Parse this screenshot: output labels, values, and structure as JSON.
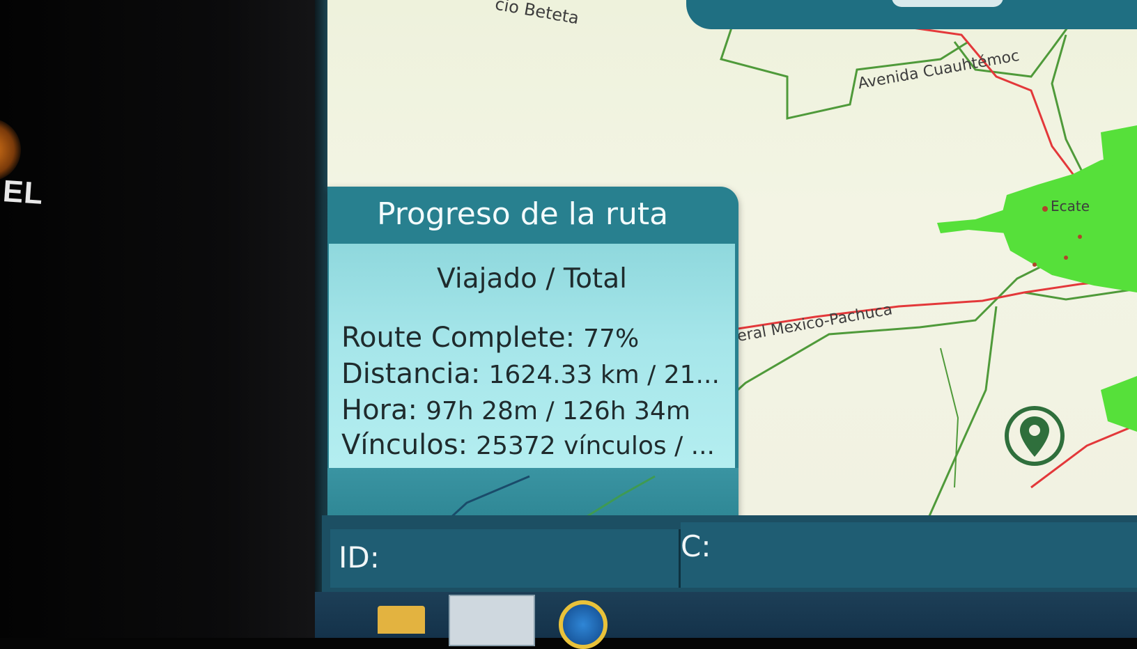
{
  "monitor_brand_text": "EL",
  "map": {
    "labels": {
      "top_left_street": "cio Beteta",
      "top_street": "Avenida Cuauhtémoc",
      "highway": "Federal Mexico-Pachuca",
      "town_right": "Ecate"
    }
  },
  "route_progress": {
    "title": "Progreso de la ruta",
    "subtitle": "Viajado / Total",
    "lines": [
      {
        "key": "Route Complete:",
        "value": "77%"
      },
      {
        "key": "Distancia:",
        "value": "1624.33 km / 21..."
      },
      {
        "key": "Hora:",
        "value": "97h 28m / 126h 34m"
      },
      {
        "key": "Vínculos:",
        "value": "25372 vínculos / ..."
      }
    ],
    "percent_complete": 77
  },
  "status_bar": {
    "id_label": "ID:",
    "c_label": "C:"
  },
  "icons": [
    "location-pin-icon",
    "folder-icon",
    "window-icon",
    "browser-icon"
  ],
  "colors": {
    "panel_header": "#28808f",
    "panel_body": "#a6e6ea",
    "route_red": "#e3383a",
    "road_green": "#4f9a3a",
    "area_green": "#56e03a"
  }
}
